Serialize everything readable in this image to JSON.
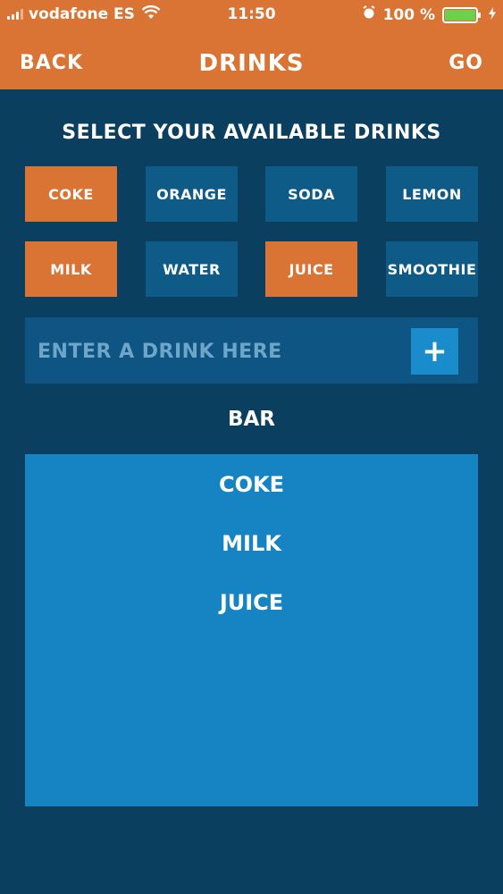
{
  "status_bar": {
    "carrier": "vodafone ES",
    "time": "11:50",
    "battery": "100 %",
    "icons": [
      "signal-icon",
      "wifi-icon",
      "alarm-icon",
      "battery-icon",
      "charging-icon"
    ]
  },
  "nav": {
    "back_label": "BACK",
    "title": "DRINKS",
    "go_label": "GO",
    "background": "#d97434"
  },
  "heading": "SELECT YOUR AVAILABLE DRINKS",
  "drinks": [
    {
      "label": "COKE",
      "selected": true
    },
    {
      "label": "ORANGE",
      "selected": false
    },
    {
      "label": "SODA",
      "selected": false
    },
    {
      "label": "LEMON",
      "selected": false
    },
    {
      "label": "MILK",
      "selected": true
    },
    {
      "label": "WATER",
      "selected": false
    },
    {
      "label": "JUICE",
      "selected": true
    },
    {
      "label": "SMOOTHIE",
      "selected": false
    }
  ],
  "add_drink": {
    "placeholder": "ENTER A DRINK HERE",
    "button_label": "+"
  },
  "bar": {
    "title": "BAR",
    "items": [
      "COKE",
      "MILK",
      "JUICE"
    ]
  },
  "colors": {
    "accent": "#d97434",
    "background": "#0b3f60",
    "chip": "#0f5b88",
    "bar_panel": "#1684c3"
  }
}
